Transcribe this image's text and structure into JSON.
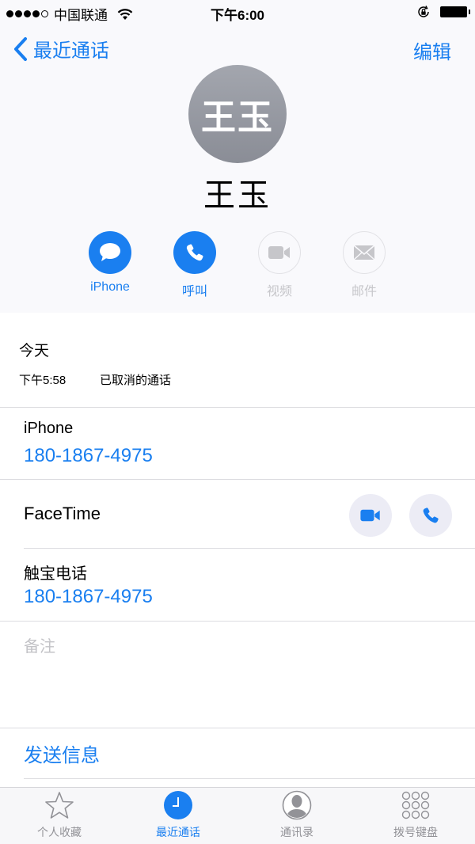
{
  "status_bar": {
    "signal_bars_filled": 4,
    "signal_bars_total": 5,
    "carrier": "中国联通",
    "time": "下午6:00"
  },
  "nav": {
    "back_label": "最近通话",
    "edit_label": "编辑"
  },
  "contact": {
    "avatar_initials": "王玉",
    "name": "王玉"
  },
  "actions": [
    {
      "label": "iPhone",
      "icon": "message-icon",
      "enabled": true
    },
    {
      "label": "呼叫",
      "icon": "phone-icon",
      "enabled": true
    },
    {
      "label": "视频",
      "icon": "video-icon",
      "enabled": false
    },
    {
      "label": "邮件",
      "icon": "mail-icon",
      "enabled": false
    }
  ],
  "recent_calls": {
    "day": "今天",
    "entries": [
      {
        "time": "下午5:58",
        "status": "已取消的通话"
      }
    ]
  },
  "fields": {
    "iphone": {
      "label": "iPhone",
      "value": "180-1867-4975"
    },
    "facetime": {
      "label": "FaceTime"
    },
    "touchpal": {
      "label": "触宝电话",
      "value": "180-1867-4975"
    },
    "notes_placeholder": "备注"
  },
  "send_message_label": "发送信息",
  "tabbar": {
    "items": [
      {
        "label": "个人收藏",
        "icon": "star-icon",
        "active": false
      },
      {
        "label": "最近通话",
        "icon": "clock-icon",
        "active": true
      },
      {
        "label": "通讯录",
        "icon": "person-icon",
        "active": false
      },
      {
        "label": "拨号键盘",
        "icon": "keypad-icon",
        "active": false
      }
    ]
  },
  "colors": {
    "accent": "#1a7ff0",
    "disabled": "#c6c6ca",
    "header_bg": "#f9f9fc",
    "avatar_bg": "#9a9da5"
  }
}
